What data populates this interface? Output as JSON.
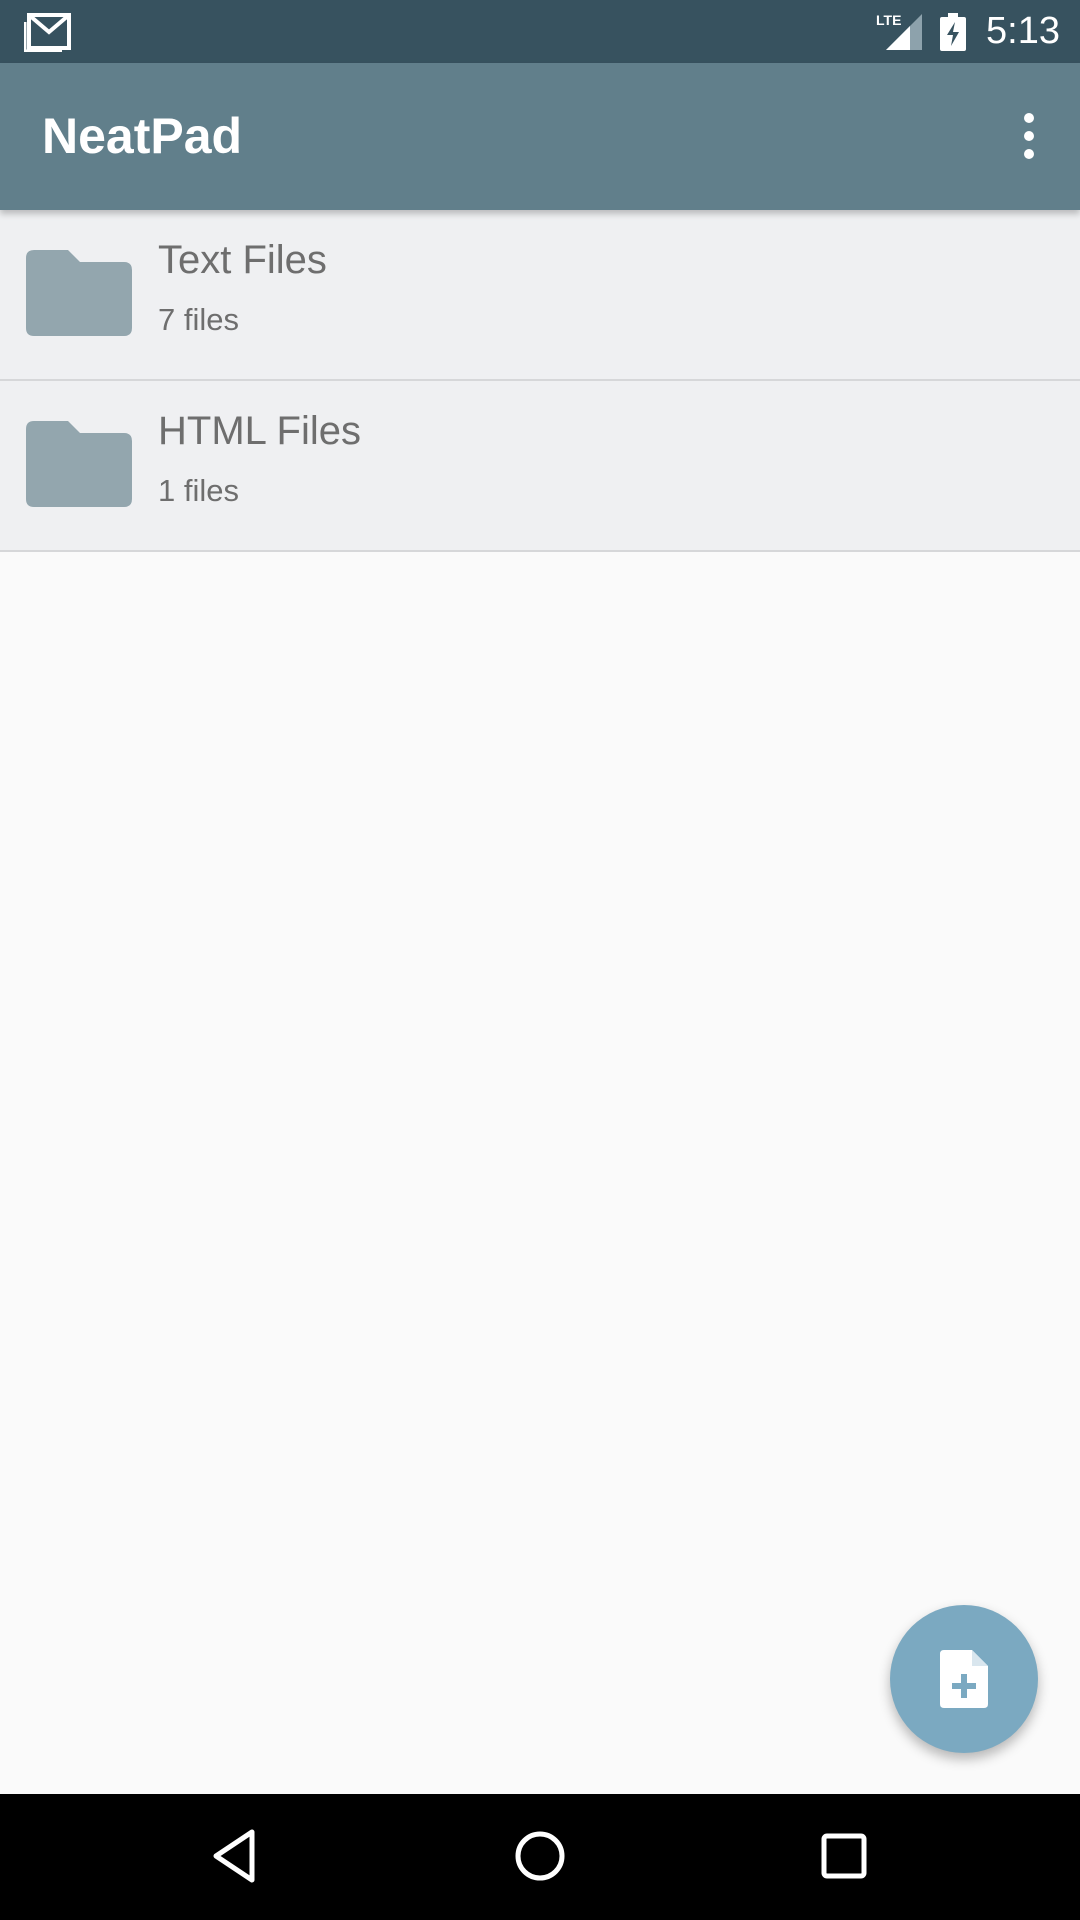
{
  "status_bar": {
    "time": "5:13",
    "network": "LTE",
    "icons": [
      "gmail-icon",
      "lte-signal-icon",
      "battery-charging-icon"
    ]
  },
  "app_bar": {
    "title": "NeatPad",
    "overflow_icon": "more-vert-icon"
  },
  "folders": [
    {
      "name": "Text Files",
      "count": "7 files",
      "icon": "folder-icon"
    },
    {
      "name": "HTML Files",
      "count": "1 files",
      "icon": "folder-icon"
    }
  ],
  "fab": {
    "icon": "new-file-icon",
    "color": "#7ba9c1"
  },
  "nav_bar": {
    "icons": [
      "back-icon",
      "home-icon",
      "recents-icon"
    ]
  },
  "colors": {
    "status_bar": "#37525f",
    "app_bar": "#617f8b",
    "list_item_bg": "#eff0f2",
    "folder_icon": "#93a6ae"
  }
}
